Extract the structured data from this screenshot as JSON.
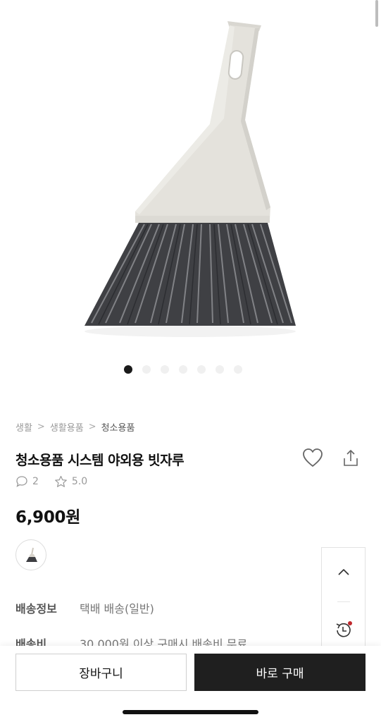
{
  "gallery": {
    "image_alt": "청소용품 시스템 야외용 빗자루",
    "slide_count": 7,
    "active_slide": 1
  },
  "breadcrumb": {
    "items": [
      "생활",
      "생활용품",
      "청소용품"
    ]
  },
  "product": {
    "name": "청소용품 시스템 야외용 빗자루",
    "review_count": "2",
    "rating": "5.0",
    "price": "6,900원"
  },
  "info": {
    "delivery_label": "배송정보",
    "delivery_value": "택배 배송(일반)",
    "fee_label": "배송비",
    "fee_value": "30,000원 이상 구매시 배송비 무료"
  },
  "bottom_bar": {
    "cart_label": "장바구니",
    "buy_label": "바로 구매"
  },
  "icons": {
    "wishlist": "heart-icon",
    "share": "share-icon",
    "review": "speech-bubble-icon",
    "rating": "star-icon",
    "scroll_top": "chevron-up-icon",
    "recent": "history-icon"
  },
  "colors": {
    "primary": "#1f1f1f",
    "notification_dot": "#c0282d",
    "muted_text": "#9a9a9a"
  }
}
